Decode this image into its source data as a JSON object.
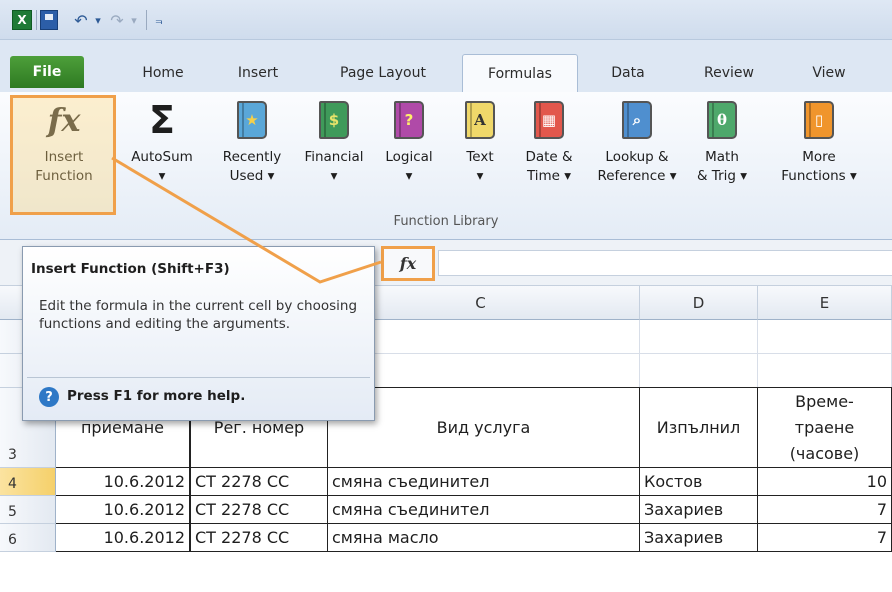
{
  "app": {
    "logo_letter": "X",
    "undo_glyph": "↶",
    "redo_glyph": "↷",
    "dropdown_glyph": "▾",
    "customize_glyph": "⫬"
  },
  "tabs": [
    {
      "label": "File"
    },
    {
      "label": "Home"
    },
    {
      "label": "Insert"
    },
    {
      "label": "Page Layout"
    },
    {
      "label": "Formulas"
    },
    {
      "label": "Data"
    },
    {
      "label": "Review"
    },
    {
      "label": "View"
    }
  ],
  "ribbon": {
    "group_label": "Function Library",
    "buttons": [
      {
        "line1": "Insert",
        "line2": "Function",
        "icon": "fx-icon",
        "glyph": "fx"
      },
      {
        "line1": "AutoSum",
        "line2": "▾",
        "icon": "sigma-icon",
        "glyph": "Σ"
      },
      {
        "line1": "Recently",
        "line2": "Used ▾",
        "icon": "star-book-icon",
        "glyph": "★",
        "color": "#5aa7d8"
      },
      {
        "line1": "Financial",
        "line2": "▾",
        "icon": "money-book-icon",
        "glyph": "$",
        "color": "#3f9a5a"
      },
      {
        "line1": "Logical",
        "line2": "▾",
        "icon": "question-book-icon",
        "glyph": "?",
        "color": "#b04aa8"
      },
      {
        "line1": "Text",
        "line2": "▾",
        "icon": "text-book-icon",
        "glyph": "A",
        "color": "#f0d86a"
      },
      {
        "line1": "Date &",
        "line2": "Time ▾",
        "icon": "calendar-book-icon",
        "glyph": "▦",
        "color": "#e2574c"
      },
      {
        "line1": "Lookup &",
        "line2": "Reference ▾",
        "icon": "magnifier-book-icon",
        "glyph": "⌕",
        "color": "#4f8fcf"
      },
      {
        "line1": "Math",
        "line2": "& Trig ▾",
        "icon": "theta-book-icon",
        "glyph": "θ",
        "color": "#4ea86b"
      },
      {
        "line1": "More",
        "line2": "Functions ▾",
        "icon": "books-icon",
        "glyph": "▯",
        "color": "#f0952c"
      }
    ]
  },
  "formula_bar": {
    "fx_label": "fx",
    "value": ""
  },
  "tooltip": {
    "title": "Insert Function (Shift+F3)",
    "body": "Edit the formula in the current cell by choosing functions and editing the arguments.",
    "help_icon": "?",
    "help": "Press F1 for more help."
  },
  "sheet": {
    "columns": [
      "C",
      "D",
      "E"
    ],
    "row_numbers": [
      "3",
      "4",
      "5",
      "6"
    ],
    "header_row": [
      "приемане",
      "Рег. номер",
      "Вид услуга",
      "Изпълнил",
      "Време-\nтраене\n(часове)"
    ],
    "rows": [
      [
        "10.6.2012",
        "СТ 2278 СС",
        "смяна съединител",
        "Костов",
        "10"
      ],
      [
        "10.6.2012",
        "СТ 2278 СС",
        "смяна съединител",
        "Захариев",
        "7"
      ],
      [
        "10.6.2012",
        "СТ 2278 СС",
        "смяна масло",
        "Захариев",
        "7"
      ]
    ]
  }
}
